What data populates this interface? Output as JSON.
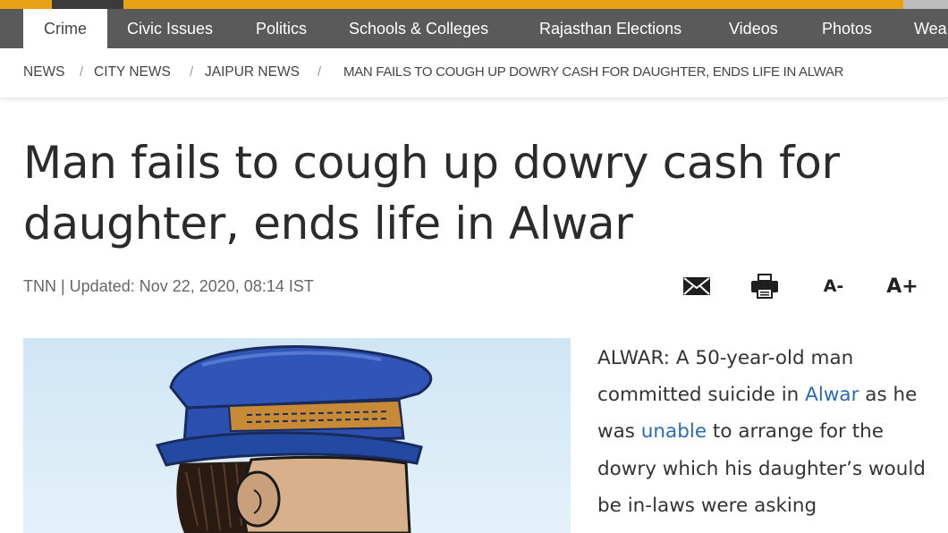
{
  "nav": {
    "items": [
      {
        "label": "Crime",
        "active": true
      },
      {
        "label": "Civic Issues"
      },
      {
        "label": "Politics"
      },
      {
        "label": "Schools & Colleges"
      },
      {
        "label": "Rajasthan Elections"
      },
      {
        "label": "Videos"
      },
      {
        "label": "Photos"
      },
      {
        "label": "Wea"
      }
    ]
  },
  "breadcrumb": {
    "items": [
      "NEWS",
      "CITY NEWS",
      "JAIPUR NEWS",
      "MAN FAILS TO COUGH UP DOWRY CASH FOR DAUGHTER, ENDS LIFE IN ALWAR"
    ],
    "separator": "/"
  },
  "article": {
    "headline_line1": "Man fails to cough up dowry cash for",
    "headline_line2": "daughter, ends life in Alwar",
    "byline": "TNN | Updated: Nov 22, 2020, 08:14 IST",
    "body": {
      "p1_a": "ALWAR: A 50-year-old man committed suicide in ",
      "p1_link1": "Alwar",
      "p1_b": " as he was ",
      "p1_link2": "unable",
      "p1_c": " to arrange for the dowry which his daughter’s would be in-laws were asking"
    }
  },
  "tools": {
    "email_icon": "mail-icon",
    "print_icon": "printer-icon",
    "font_decrease": "A-",
    "font_increase": "A+"
  },
  "colors": {
    "nav_background": "#5a5a5a",
    "accent": "#e8a315",
    "link": "#2a6bb8"
  }
}
